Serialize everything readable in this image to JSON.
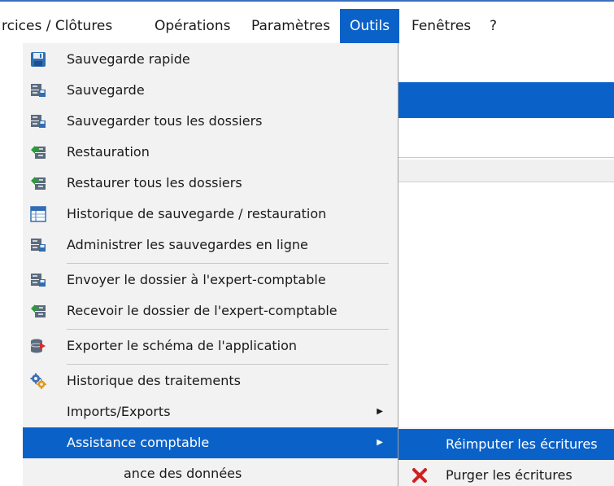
{
  "menubar": {
    "items": [
      {
        "label": "rcices / Clôtures"
      },
      {
        "label": "Opérations"
      },
      {
        "label": "Paramètres"
      },
      {
        "label": "Outils"
      },
      {
        "label": "Fenêtres"
      },
      {
        "label": "?"
      }
    ],
    "active_index": 3
  },
  "outils_menu": {
    "items": [
      {
        "label": "Sauvegarde rapide",
        "icon": "floppy-save-icon"
      },
      {
        "label": "Sauvegarde",
        "icon": "server-save-icon"
      },
      {
        "label": "Sauvegarder tous les dossiers",
        "icon": "server-save-all-icon"
      },
      {
        "label": "Restauration",
        "icon": "restore-icon"
      },
      {
        "label": "Restaurer tous les dossiers",
        "icon": "restore-all-icon"
      },
      {
        "label": "Historique de sauvegarde / restauration",
        "icon": "history-table-icon"
      },
      {
        "label": "Administrer les sauvegardes en ligne",
        "icon": "online-backup-icon"
      },
      {
        "label": "Envoyer le dossier à l'expert-comptable",
        "icon": "send-folder-icon"
      },
      {
        "label": "Recevoir le dossier de l'expert-comptable",
        "icon": "receive-folder-icon"
      },
      {
        "label": "Exporter le schéma de l'application",
        "icon": "export-schema-icon"
      },
      {
        "label": "Historique des traitements",
        "icon": "gears-icon"
      },
      {
        "label": "Imports/Exports"
      },
      {
        "label": "Assistance comptable"
      },
      {
        "label": "ance des données"
      }
    ],
    "active_label": "Assistance comptable"
  },
  "assistance_submenu": {
    "items": [
      {
        "label": "Réimputer les écritures"
      },
      {
        "label": "Purger les écritures",
        "icon": "red-x-icon"
      }
    ]
  },
  "colors": {
    "highlight": "#0a62c9",
    "menu_bg": "#f2f2f2",
    "topline": "#3a6fc0"
  }
}
